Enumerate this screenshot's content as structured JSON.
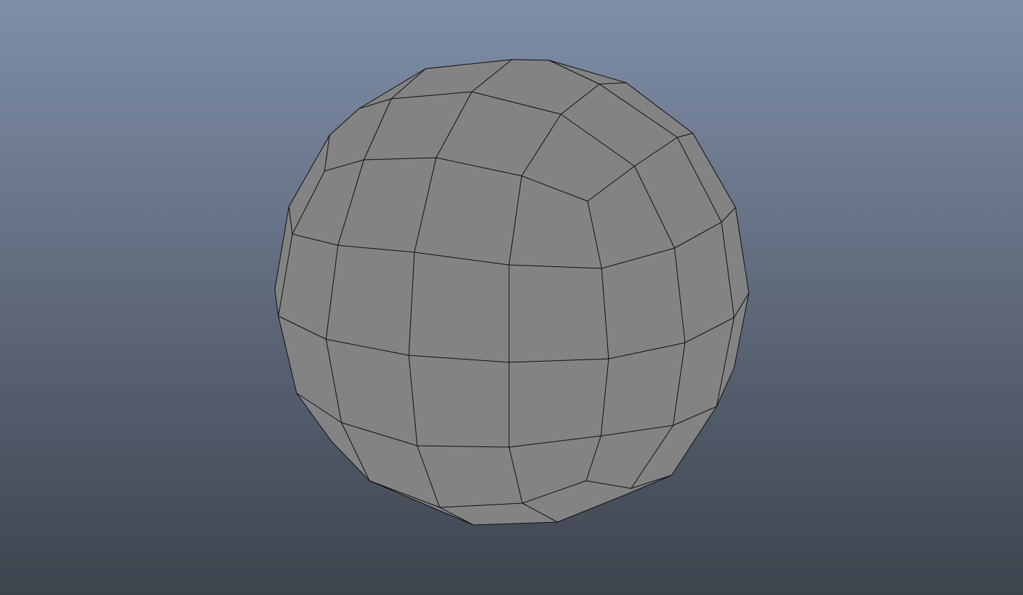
{
  "viewport": {
    "background_top": "#7f8ea8",
    "background_bottom": "#3e444e"
  },
  "mesh": {
    "object": "sphere-icon",
    "face_color": "#838383",
    "wire_color": "#0d0d0d"
  }
}
